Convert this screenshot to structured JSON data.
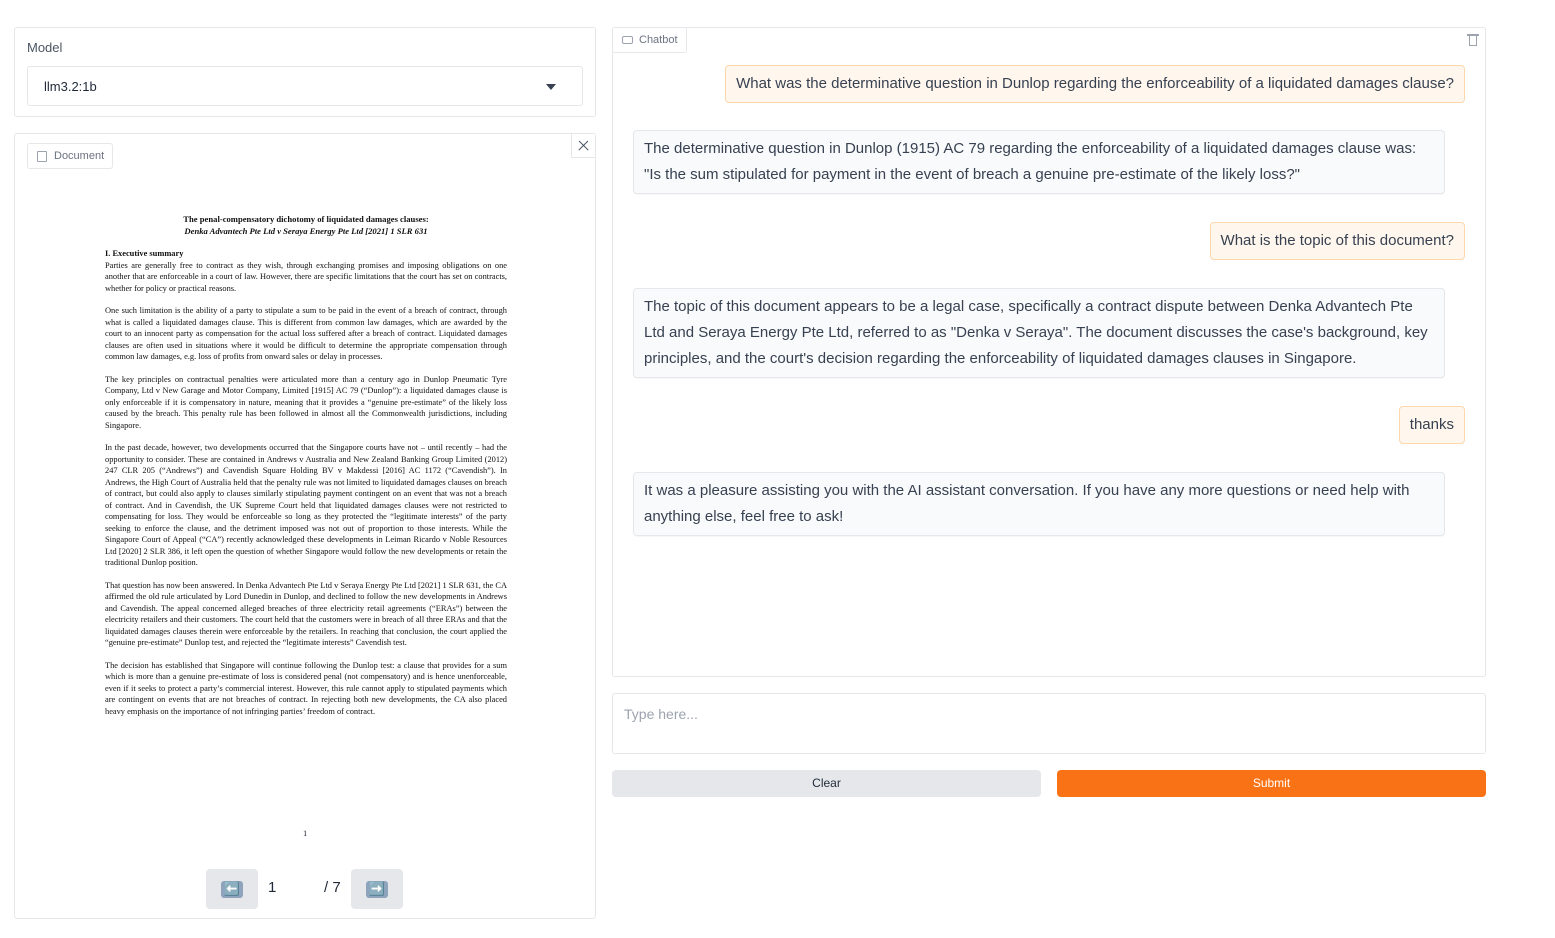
{
  "model": {
    "label": "Model",
    "selected": "llm3.2:1b"
  },
  "document": {
    "tag_label": "Document",
    "pdf": {
      "title": "The penal-compensatory dichotomy of liquidated damages clauses:",
      "subtitle": "Denka Advantech Pte Ltd v Seraya Energy Pte Ltd [2021] 1 SLR 631",
      "heading": "I.        Executive summary",
      "paragraphs": [
        "Parties are generally free to contract as they wish, through exchanging promises and imposing obligations on one another that are enforceable in a court of law. However, there are specific limitations that the court has set on contracts, whether for policy or practical reasons.",
        "One such limitation is the ability of a party to stipulate a sum to be paid in the event of a breach of contract, through what is called a liquidated damages clause. This is different from common law damages, which are awarded by the court to an innocent party as compensation for the actual loss suffered after a breach of contract. Liquidated damages clauses are often used in situations where it would be difficult to determine the appropriate compensation through common law damages, e.g. loss of profits from onward sales or delay in processes.",
        "The key principles on contractual penalties were articulated more than a century ago in Dunlop Pneumatic Tyre Company, Ltd v New Garage and Motor Company, Limited [1915] AC 79 (“Dunlop”): a liquidated damages clause is only enforceable if it is compensatory in nature, meaning that it provides a “genuine pre-estimate” of the likely loss caused by the breach. This penalty rule has been followed in almost all the Commonwealth jurisdictions, including Singapore.",
        "In the past decade, however, two developments occurred that the Singapore courts have not – until recently – had the opportunity to consider. These are contained in Andrews v Australia and New Zealand Banking Group Limited (2012) 247 CLR 205 (“Andrews”) and Cavendish Square Holding BV v Makdessi [2016] AC 1172 (“Cavendish”). In Andrews, the High Court of Australia held that the penalty rule was not limited to liquidated damages clauses on breach of contract, but could also apply to clauses similarly stipulating payment contingent on an event that was not a breach of contract. And in Cavendish, the UK Supreme Court held that liquidated damages clauses were not restricted to compensating for loss. They would be enforceable so long as they protected the “legitimate interests” of the party seeking to enforce the clause, and the detriment imposed was not out of proportion to those interests. While the Singapore Court of Appeal (“CA”) recently acknowledged these developments in Leiman Ricardo v Noble Resources Ltd [2020] 2 SLR 386, it left open the question of whether Singapore would follow the new developments or retain the traditional Dunlop position.",
        "That question has now been answered. In Denka Advantech Pte Ltd v Seraya Energy Pte Ltd [2021] 1 SLR 631, the CA affirmed the old rule articulated by Lord Dunedin in Dunlop, and declined to follow the new developments in Andrews and Cavendish. The appeal concerned alleged breaches of three electricity retail agreements (“ERAs”) between the electricity retailers and their customers. The court held that the customers were in breach of all three ERAs and that the liquidated damages clauses therein were enforceable by the retailers. In reaching that conclusion, the court applied the “genuine pre-estimate” Dunlop test, and rejected the “legitimate interests” Cavendish test.",
        "The decision has established that Singapore will continue following the Dunlop test: a clause that provides for a sum which is more than a genuine pre-estimate of loss is considered penal (not compensatory) and is hence unenforceable, even if it seeks to protect a party’s commercial interest. However, this rule cannot apply to stipulated payments which are contingent on events that are not breaches of contract. In rejecting both new developments, the CA also placed heavy emphasis on the importance of not infringing parties’ freedom of contract."
      ],
      "page_number": "1"
    },
    "pager": {
      "prev_icon": "⬅️",
      "next_icon": "➡️",
      "current_page": "1",
      "total_pages": "/ 7"
    }
  },
  "chat": {
    "tag_label": "Chatbot",
    "messages": [
      {
        "role": "user",
        "text": "What was the determinative question in Dunlop regarding the enforceability of a liquidated damages clause?"
      },
      {
        "role": "bot",
        "text": "The determinative question in Dunlop (1915) AC 79 regarding the enforceability of a liquidated damages clause was: \"Is the sum stipulated for payment in the event of breach a genuine pre-estimate of the likely loss?\""
      },
      {
        "role": "user",
        "text": "What is the topic of this document?"
      },
      {
        "role": "bot",
        "text": "The topic of this document appears to be a legal case, specifically a contract dispute between Denka Advantech Pte Ltd and Seraya Energy Pte Ltd, referred to as \"Denka v Seraya\". The document discusses the case's background, key principles, and the court's decision regarding the enforceability of liquidated damages clauses in Singapore."
      },
      {
        "role": "user",
        "text": "thanks"
      },
      {
        "role": "bot",
        "text": "It was a pleasure assisting you with the AI assistant conversation. If you have any more questions or need help with anything else, feel free to ask!"
      }
    ]
  },
  "input": {
    "placeholder": "Type here..."
  },
  "buttons": {
    "clear_label": "Clear",
    "submit_label": "Submit"
  },
  "colors": {
    "accent": "#f97316",
    "user_bubble": "#fff7ed",
    "bot_bubble": "#f9fafb"
  },
  "icons": {
    "document_tag": "file-icon",
    "chat_tag": "chat-bubble-icon",
    "clear_chat": "trash-icon",
    "close_document": "close-icon",
    "model_dropdown": "chevron-down-icon"
  }
}
